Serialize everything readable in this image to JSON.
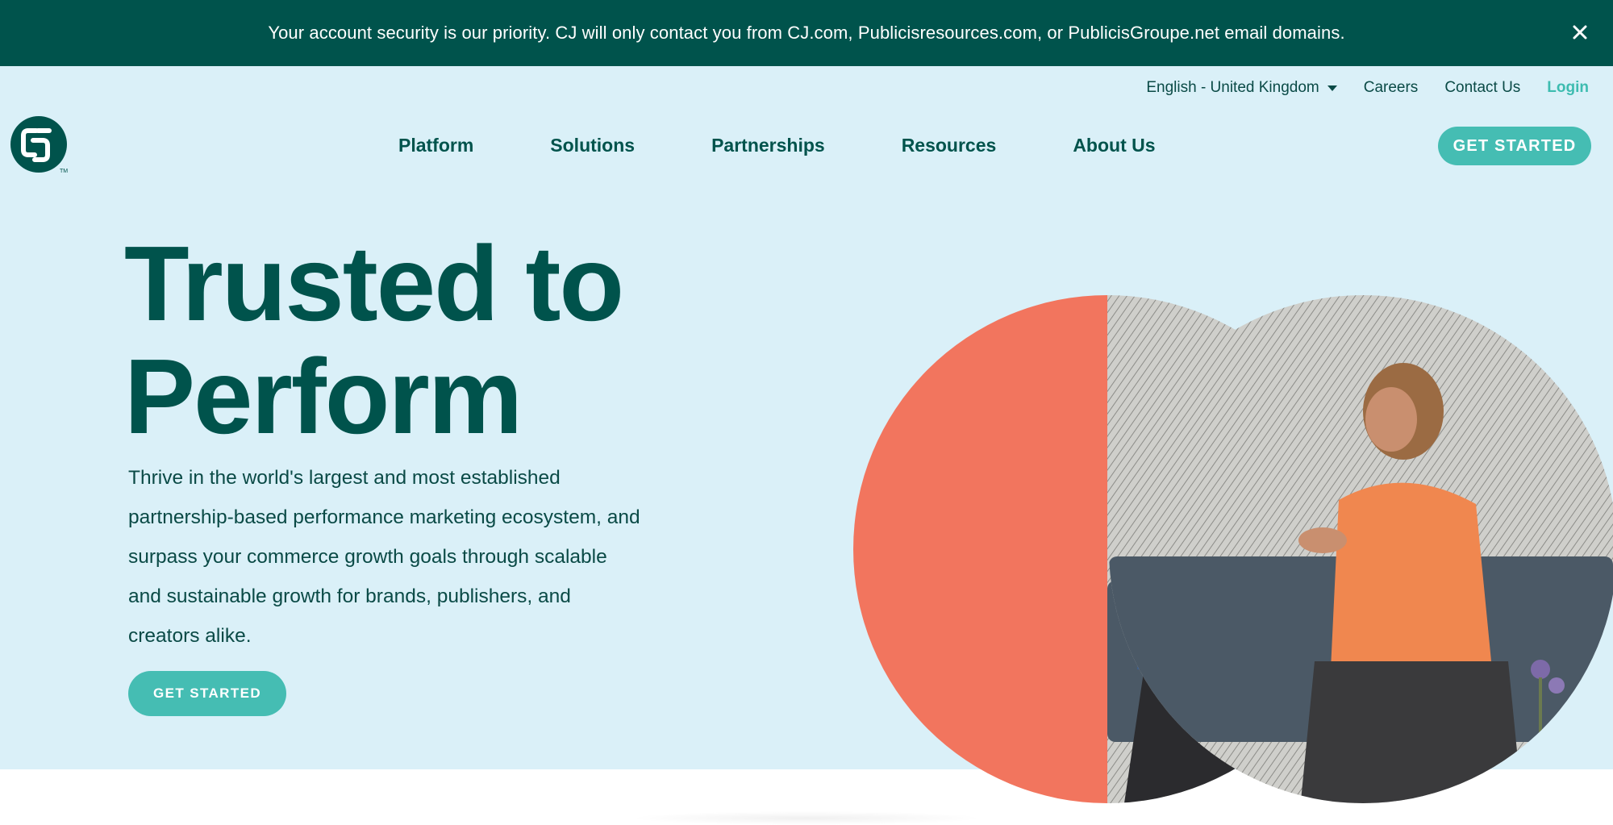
{
  "banner": {
    "message": "Your account security is our priority. CJ will only contact you from CJ.com, Publicisresources.com, or PublicisGroupe.net email domains.",
    "close_icon": "close-icon"
  },
  "utility_nav": {
    "language": "English - United Kingdom",
    "careers": "Careers",
    "contact": "Contact Us",
    "login": "Login"
  },
  "logo": {
    "letters": "CJ",
    "trademark": "TM"
  },
  "main_nav": {
    "items": [
      {
        "label": "Platform"
      },
      {
        "label": "Solutions"
      },
      {
        "label": "Partnerships"
      },
      {
        "label": "Resources"
      },
      {
        "label": "About Us"
      }
    ],
    "cta": "GET STARTED"
  },
  "hero": {
    "title_line1": "Trusted to",
    "title_line2": "Perform",
    "description": "Thrive in the world's largest and most established partnership-based performance marketing ecosystem, and surpass your commerce growth goals through scalable and sustainable growth for brands, publishers, and creators alike.",
    "cta": "GET STARTED",
    "image_description_icon": "people-meeting-illustration"
  },
  "colors": {
    "banner_bg": "#00534c",
    "hero_bg": "#daf0f8",
    "brand_dark": "#00534c",
    "accent_teal": "#45bdb3",
    "coral": "#f2755e"
  }
}
